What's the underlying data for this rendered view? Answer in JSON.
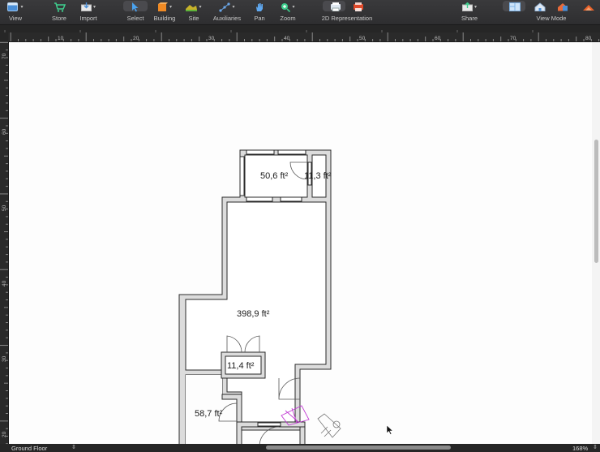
{
  "toolbar": {
    "items": [
      {
        "label": "View"
      },
      {
        "label": "Store"
      },
      {
        "label": "Import"
      },
      {
        "label": "Select"
      },
      {
        "label": "Building"
      },
      {
        "label": "Site"
      },
      {
        "label": "Auxiliaries"
      },
      {
        "label": "Pan"
      },
      {
        "label": "Zoom"
      },
      {
        "label": "2D Representation"
      },
      {
        "label": "Share"
      },
      {
        "label": "View Mode"
      }
    ]
  },
  "ruler": {
    "horizontal": [
      "10",
      "20",
      "30",
      "40",
      "50",
      "60",
      "70",
      "80"
    ],
    "vertical": [
      "70",
      "60",
      "50",
      "40",
      "30",
      "20"
    ]
  },
  "floorplan": {
    "rooms": [
      {
        "area": "50,6 ft²"
      },
      {
        "area": "11,3 ft²"
      },
      {
        "area": "398,9 ft²"
      },
      {
        "area": "11,4 ft²"
      },
      {
        "area": "58,7 ft²"
      }
    ]
  },
  "status": {
    "floor": "Ground Floor",
    "zoom": "168%"
  },
  "colors": {
    "toolbar_bg": "#333335",
    "canvas_bg": "#fdfdfd",
    "wall_fill": "#d9d9d9",
    "stair_accent": "#c23bd4"
  }
}
